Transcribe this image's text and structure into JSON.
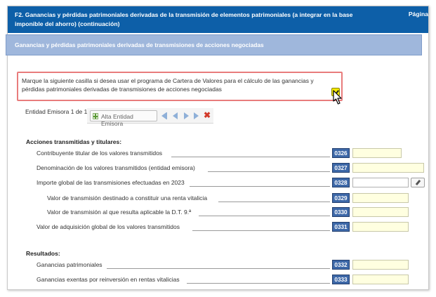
{
  "header": {
    "title": "F2.  Ganancias y pérdidas patrimoniales derivadas de la transmisión de elementos patrimoniales (a integrar en la base imponible del ahorro) (continuación)",
    "page_label": "Página"
  },
  "section": {
    "title": "Ganancias y pérdidas patrimoniales derivadas de transmisiones de acciones negociadas"
  },
  "notice": {
    "text": "Marque la siguiente casilla si desea usar el programa de Cartera de Valores para el cálculo de las ganancias y pérdidas patrimoniales derivadas de transmisiones de acciones negociadas",
    "checked": true
  },
  "emisora": {
    "label": "Entidad Emisora 1 de 1",
    "add_button": "Alta Entidad Emisora"
  },
  "acciones": {
    "title": "Acciones transmitidas y titulares:",
    "rows": [
      {
        "label": "Contribuyente titular de los valores transmitidos",
        "code": "0326"
      },
      {
        "label": "Denominación de los valores transmitidos (entidad emisora)",
        "code": "0327"
      },
      {
        "label": "Importe global de las transmisiones efectuadas en 2023",
        "code": "0328"
      },
      {
        "label": "Valor de transmisión destinado a constituir una renta vitalicia",
        "code": "0329"
      },
      {
        "label": "Valor de transmisión al que resulta aplicable la D.T. 9.ª",
        "code": "0330"
      },
      {
        "label": "Valor de adquisición global de los valores transmitidos",
        "code": "0331"
      }
    ]
  },
  "resultados": {
    "title": "Resultados:",
    "rows": [
      {
        "label": "Ganancias patrimoniales",
        "code": "0332"
      },
      {
        "label": "Ganancias exentas por reinversión en rentas vitalicias",
        "code": "0333"
      }
    ]
  },
  "colors": {
    "header_bg": "#0d5fa8",
    "section_bg": "#9fb7dc",
    "code_bg": "#3d68a8",
    "field_bg": "#ffffe0",
    "notice_border": "#e87c7c",
    "checkbox": "#f2e800"
  }
}
